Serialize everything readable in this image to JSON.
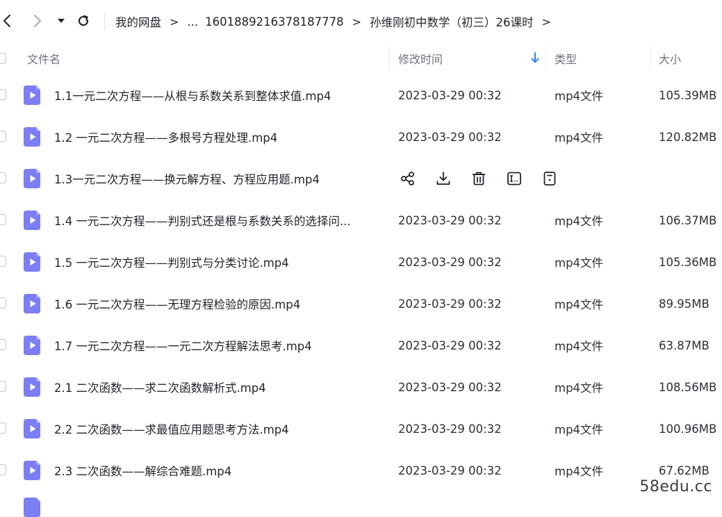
{
  "toolbar": {
    "back_icon": "chevron-left-icon",
    "forward_icon": "chevron-right-icon",
    "dropdown_icon": "caret-down-icon",
    "refresh_icon": "refresh-icon"
  },
  "breadcrumb": {
    "root": "我的网盘",
    "ellipsis": "...",
    "folder1": "1601889216378187778",
    "folder2": "孙维刚初中数学（初三）26课时",
    "separator": ">"
  },
  "table": {
    "columns": {
      "name": "文件名",
      "modified": "修改时间",
      "type": "类型",
      "size": "大小"
    },
    "sort_icon": "arrow-down-icon",
    "rows": [
      {
        "name": "1.1一元二次方程——从根与系数关系到整体求值.mp4",
        "modified": "2023-03-29 00:32",
        "type": "mp4文件",
        "size": "105.39MB"
      },
      {
        "name": "1.2 一元二次方程——多根号方程处理.mp4",
        "modified": "2023-03-29 00:32",
        "type": "mp4文件",
        "size": "120.82MB"
      },
      {
        "name": "1.3一元二次方程——换元解方程、方程应用题.mp4",
        "hovered": true
      },
      {
        "name": "1.4 一元二次方程——判别式还是根与系数关系的选择问...",
        "modified": "2023-03-29 00:32",
        "type": "mp4文件",
        "size": "106.37MB"
      },
      {
        "name": "1.5 一元二次方程——判别式与分类讨论.mp4",
        "modified": "2023-03-29 00:32",
        "type": "mp4文件",
        "size": "105.36MB"
      },
      {
        "name": "1.6 一元二次方程——无理方程检验的原因.mp4",
        "modified": "2023-03-29 00:32",
        "type": "mp4文件",
        "size": "89.95MB"
      },
      {
        "name": "1.7 一元二次方程——一元二次方程解法思考.mp4",
        "modified": "2023-03-29 00:32",
        "type": "mp4文件",
        "size": "63.87MB"
      },
      {
        "name": "2.1 二次函数——求二次函数解析式.mp4",
        "modified": "2023-03-29 00:32",
        "type": "mp4文件",
        "size": "108.56MB"
      },
      {
        "name": "2.2 二次函数——求最值应用题思考方法.mp4",
        "modified": "2023-03-29 00:32",
        "type": "mp4文件",
        "size": "100.96MB"
      },
      {
        "name": "2.3 二次函数——解综合难题.mp4",
        "modified": "2023-03-29 00:32",
        "type": "mp4文件",
        "size": "67.62MB"
      }
    ],
    "hover_actions": [
      "share-icon",
      "download-icon",
      "delete-icon",
      "rename-icon",
      "more-icon"
    ]
  },
  "colors": {
    "file_icon": "#7b7ef4",
    "sort_arrow": "#2f7cf6"
  },
  "watermark": "58edu.cc"
}
